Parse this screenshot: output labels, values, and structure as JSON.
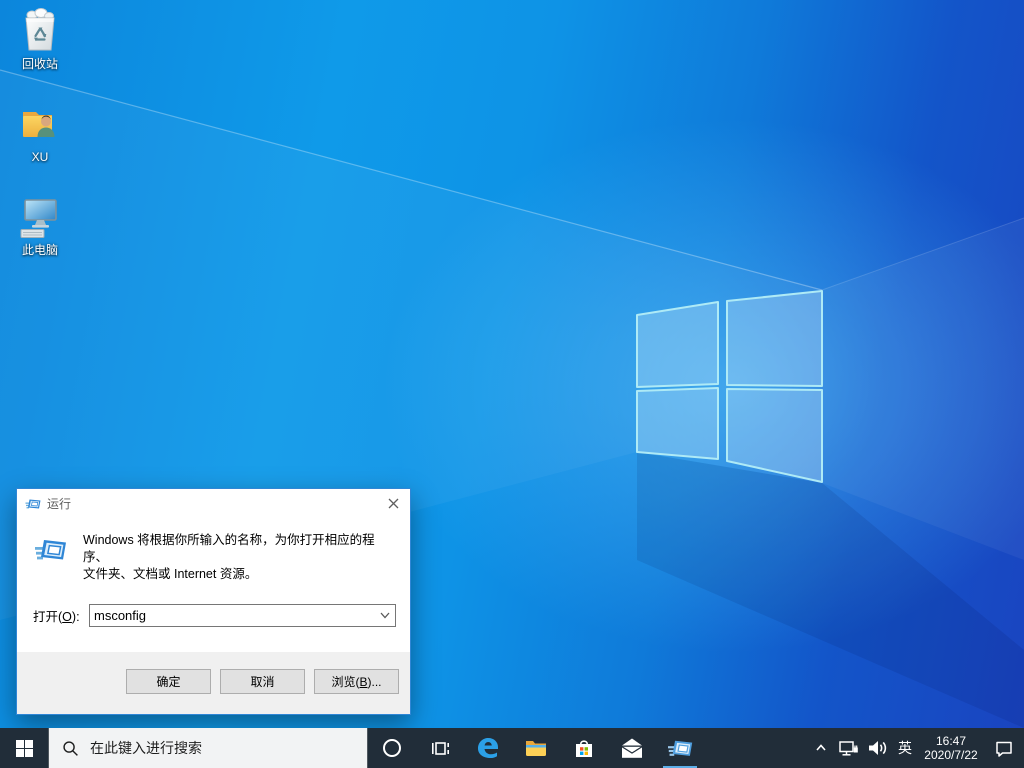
{
  "desktop": {
    "icons": [
      {
        "name": "recycle-bin",
        "label": "回收站"
      },
      {
        "name": "user-folder-xu",
        "label": "XU"
      },
      {
        "name": "this-pc",
        "label": "此电脑"
      }
    ]
  },
  "run_dialog": {
    "title": "运行",
    "description_line1": "Windows 将根据你所输入的名称，为你打开相应的程序、",
    "description_line2": "文件夹、文档或 Internet 资源。",
    "open_label": {
      "pre": "打开(",
      "key": "O",
      "post": "):"
    },
    "input_value": "msconfig",
    "buttons": {
      "ok": "确定",
      "cancel": "取消",
      "browse": {
        "pre": "浏览(",
        "key": "B",
        "post": ")..."
      }
    }
  },
  "taskbar": {
    "search_placeholder": "在此键入进行搜索",
    "tray": {
      "ime": "英",
      "time": "16:47",
      "date": "2020/7/22"
    }
  },
  "icon_names": [
    "windows-start-icon",
    "search-icon",
    "cortana-icon",
    "task-view-icon",
    "edge-icon",
    "file-explorer-icon",
    "store-icon",
    "mail-icon",
    "run-flying-window-icon",
    "chevron-up-icon",
    "network-icon",
    "volume-icon",
    "action-center-icon",
    "close-icon",
    "dropdown-chevron-icon"
  ],
  "colors": {
    "accent": "#0078d7",
    "taskbar": "#212d39",
    "wallpaper_azure": "#0f9ae9",
    "wallpaper_royal": "#1a44c0",
    "dialog_border": "#2f86d6",
    "button_face": "#e1e1e1",
    "active_app_underline": "#5caee8"
  }
}
